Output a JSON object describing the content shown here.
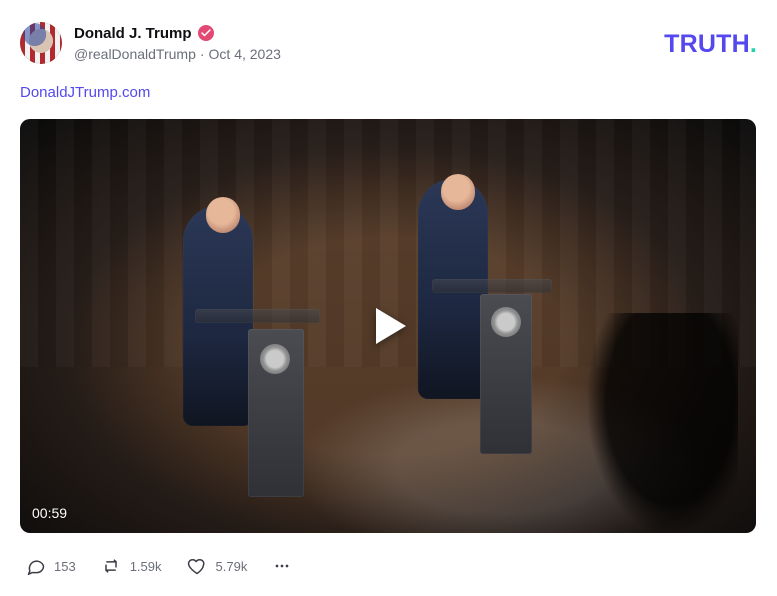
{
  "post": {
    "author": {
      "display_name": "Donald J. Trump",
      "handle": "@realDonaldTrump",
      "separator": "·",
      "date": "Oct 4, 2023",
      "verified": true,
      "verified_color": "#e24a73"
    },
    "brand": {
      "wordmark": "TRUTH",
      "wordmark_dot": ".",
      "color": "#5448ee",
      "dot_color": "#1bd6a8"
    },
    "link": {
      "text": "DonaldJTrump.com",
      "color": "#5448ee"
    },
    "media": {
      "type": "video",
      "duration": "00:59",
      "play_icon": "play-icon"
    },
    "actions": [
      {
        "name": "reply",
        "icon": "comment-icon",
        "count": "153"
      },
      {
        "name": "retruth",
        "icon": "repost-icon",
        "count": "1.59k"
      },
      {
        "name": "like",
        "icon": "heart-icon",
        "count": "5.79k"
      },
      {
        "name": "more",
        "icon": "more-icon",
        "count": ""
      }
    ]
  }
}
